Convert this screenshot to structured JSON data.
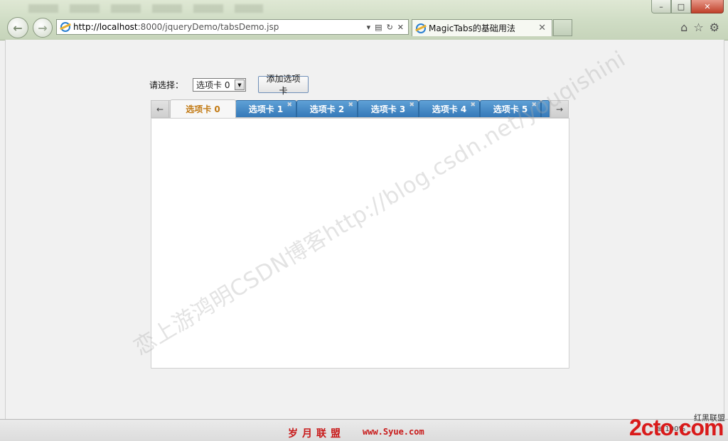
{
  "browser": {
    "address_host": "http://localhost",
    "address_path": ":8000/jqueryDemo/tabsDemo.jsp",
    "tab_title": "MagicTabs的基础用法",
    "zoom": "100%"
  },
  "page": {
    "select_label": "请选择：",
    "select_value": "选项卡 0",
    "add_button": "添加选项卡",
    "tabs": [
      {
        "label": "选项卡 0",
        "active": true,
        "closable": false
      },
      {
        "label": "选项卡 1",
        "active": false,
        "closable": true
      },
      {
        "label": "选项卡 2",
        "active": false,
        "closable": true
      },
      {
        "label": "选项卡 3",
        "active": false,
        "closable": true
      },
      {
        "label": "选项卡 4",
        "active": false,
        "closable": true
      },
      {
        "label": "选项卡 5",
        "active": false,
        "closable": true
      }
    ],
    "watermark": "恋上游鸿明CSDN博客http://blog.csdn.net/youqishini"
  },
  "status": {
    "left_text": "岁月联盟",
    "url_text": "www.Syue.com",
    "logo_text": "2cto.com",
    "logo_sub": "红黑联盟"
  },
  "colors": {
    "tab_blue": "#3579b8",
    "active_tab_text": "#c27a14",
    "status_red": "#c81818"
  },
  "icons": [
    "back-icon",
    "forward-icon",
    "ie-icon",
    "refresh-icon",
    "stop-icon",
    "home-icon",
    "star-icon",
    "gear-icon"
  ]
}
